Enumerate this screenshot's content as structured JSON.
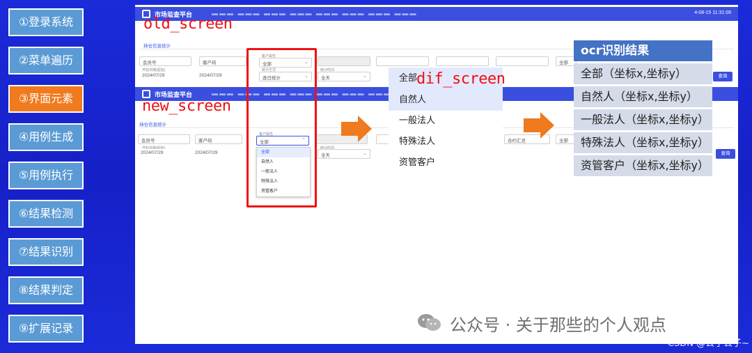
{
  "steps": [
    {
      "label": "①登录系统",
      "active": false
    },
    {
      "label": "②菜单遍历",
      "active": false
    },
    {
      "label": "③界面元素",
      "active": true
    },
    {
      "label": "④用例生成",
      "active": false
    },
    {
      "label": "⑤用例执行",
      "active": false
    },
    {
      "label": "⑥结果检测",
      "active": false
    },
    {
      "label": "⑦结果识别",
      "active": false
    },
    {
      "label": "⑧结果判定",
      "active": false
    },
    {
      "label": "⑨扩展记录",
      "active": false
    }
  ],
  "labels": {
    "old_screen": "old_screen",
    "new_screen": "new_screen",
    "dif_screen": "dif_screen"
  },
  "mini_app": {
    "title": "市场监查平台",
    "clock": "4-08-15 11:31:09",
    "tab": "持仓信息统计",
    "fields": {
      "member": "会员号",
      "account": "客户码",
      "customer_type_label": "客户属性",
      "customer_type_value": "全部",
      "start_date_label": "开始日期(起始)",
      "start_date": "2024/07/29",
      "end_date": "2024/07/29",
      "stat_method_label": "统计方式",
      "stat_method_value": "逐日统计",
      "stat_period_label": "统计时间",
      "stat_period_value": "全天",
      "summary_value": "合约汇总",
      "all_value": "全部",
      "query_button": "查询"
    },
    "dropdown_options": [
      "全部",
      "自然人",
      "一般法人",
      "特殊法人",
      "资管客户"
    ]
  },
  "dif_items": [
    "全部",
    "自然人",
    "一般法人",
    "特殊法人",
    "资管客户"
  ],
  "ocr": {
    "title": "ocr识别结果",
    "items": [
      "全部（坐标x,坐标y）",
      "自然人（坐标x,坐标y）",
      "一般法人（坐标x,坐标y）",
      "特殊法人（坐标x,坐标y）",
      "资管客户（坐标x,坐标y）"
    ]
  },
  "watermark": "公众号 · 关于那些的个人观点",
  "credit": "CSDN @公子公子~",
  "colors": {
    "background": "#1b2bd9",
    "step_box": "#5b9bd5",
    "step_active": "#f07a1e",
    "highlight_box": "#ee1111",
    "arrow": "#f07a1e",
    "ocr_header": "#4472c4",
    "ocr_item": "#d5dbe8"
  }
}
